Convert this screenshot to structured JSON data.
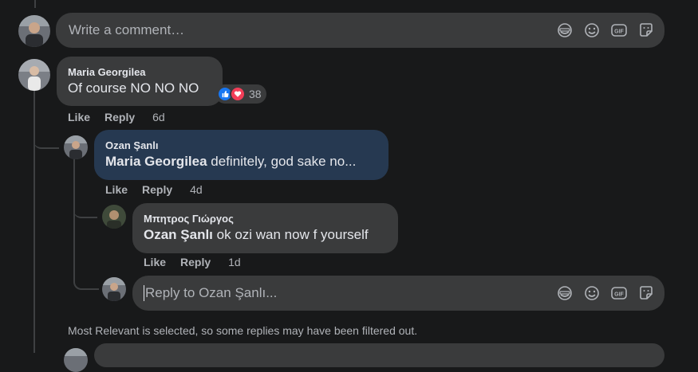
{
  "top_composer": {
    "placeholder": "Write a comment…"
  },
  "comments": [
    {
      "author": "Maria Georgilea",
      "text": "Of course NO NO NO",
      "reaction_count": "38",
      "like_label": "Like",
      "reply_label": "Reply",
      "time": "6d"
    },
    {
      "author": "Ozan Şanlı",
      "mention": "Maria Georgilea",
      "text": " definitely, god sake no...",
      "like_label": "Like",
      "reply_label": "Reply",
      "time": "4d"
    },
    {
      "author": "Μπητρος Γιώργος",
      "mention": "Ozan Şanlı",
      "text": " ok ozi wan now f yourself",
      "like_label": "Like",
      "reply_label": "Reply",
      "time": "1d"
    }
  ],
  "reply_composer": {
    "placeholder": "Reply to Ozan Şanlı..."
  },
  "filter_note": "Most Relevant is selected, so some replies may have been filtered out.",
  "colors": {
    "background": "#18191a",
    "bubble": "#3a3b3c",
    "highlight_bubble": "#263951",
    "like_blue": "#1877f2",
    "love_red": "#f33e58"
  },
  "icons": {
    "composer_icons": [
      "sticker-face-icon",
      "emoji-icon",
      "gif-icon",
      "sticker-icon"
    ],
    "reactions": [
      "like-reaction-icon",
      "love-reaction-icon"
    ]
  }
}
